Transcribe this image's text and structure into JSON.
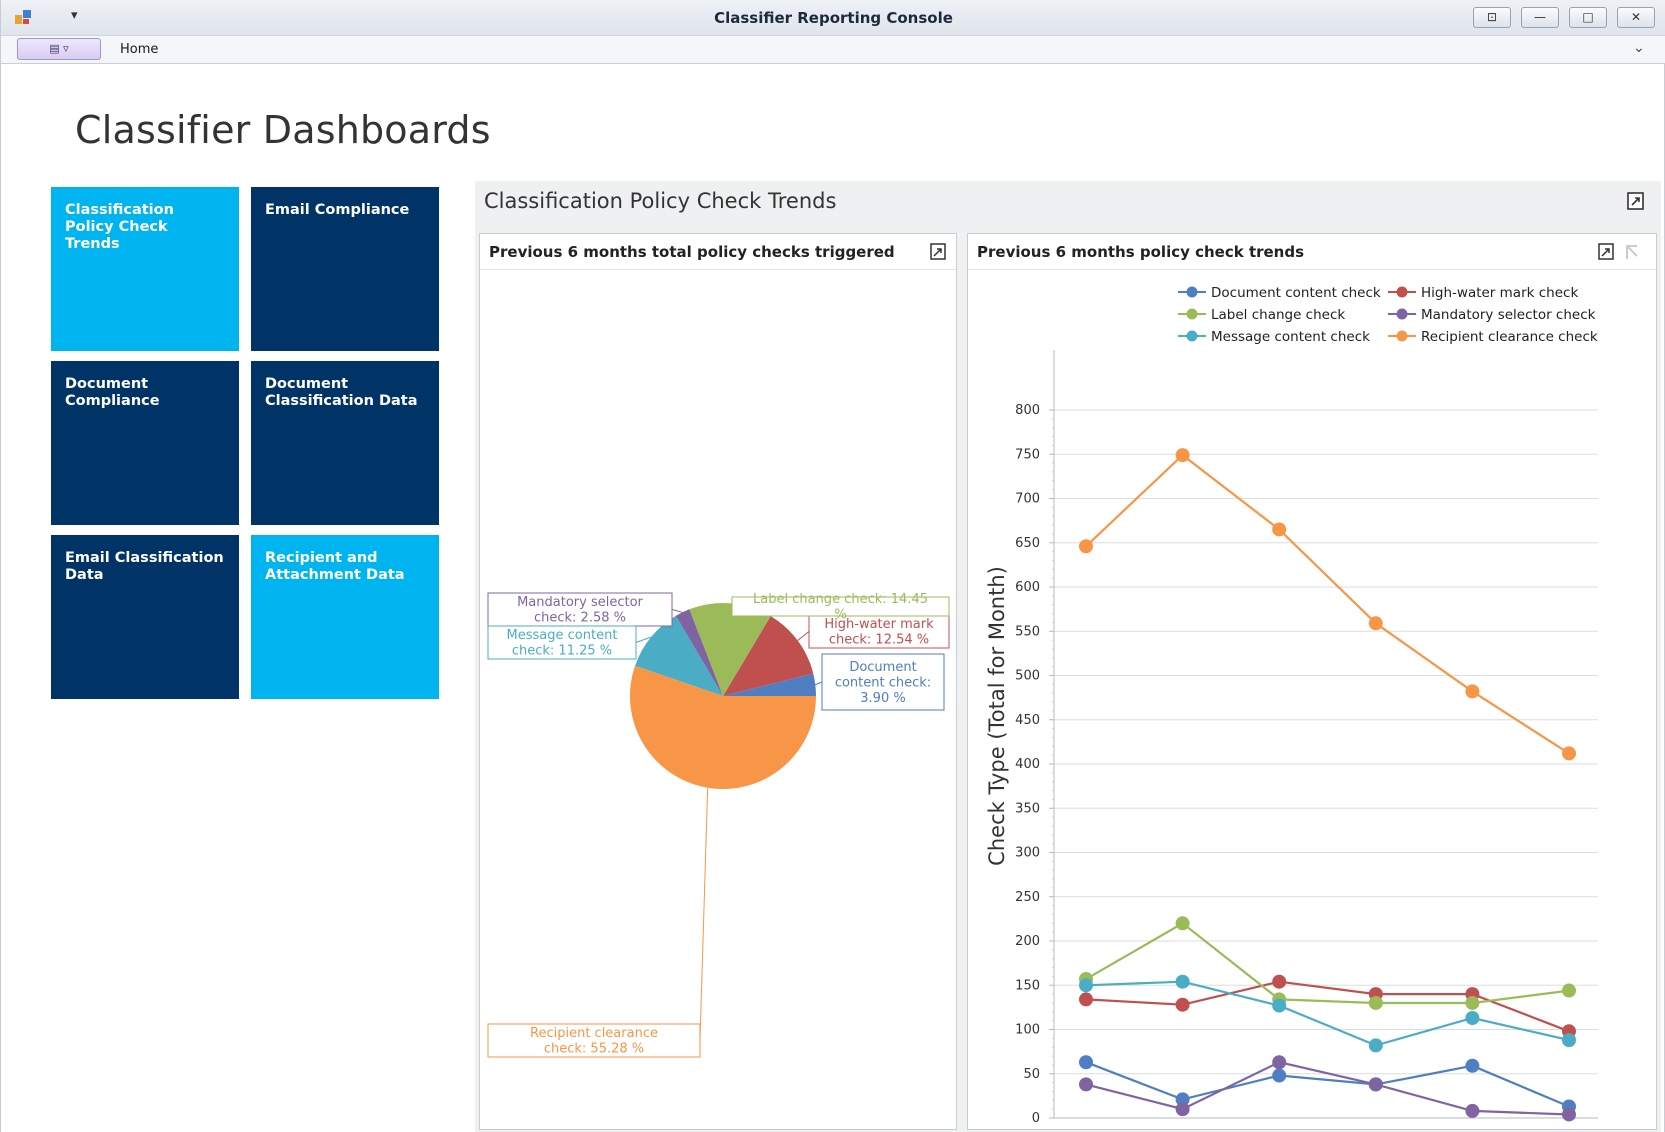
{
  "window": {
    "title": "Classifier Reporting Console"
  },
  "ribbon": {
    "tab_home": "Home"
  },
  "page": {
    "title": "Classifier Dashboards"
  },
  "tiles": [
    {
      "label": "Classification Policy Check Trends",
      "style": "light"
    },
    {
      "label": "Email Compliance",
      "style": "dark"
    },
    {
      "label": "Document Compliance",
      "style": "dark"
    },
    {
      "label": "Document Classification Data",
      "style": "dark"
    },
    {
      "label": "Email Classification Data",
      "style": "dark"
    },
    {
      "label": "Recipient and Attachment Data",
      "style": "light"
    }
  ],
  "dashboard": {
    "title": "Classification Policy Check Trends"
  },
  "colors": {
    "tile_light": "#00b4f0",
    "tile_dark": "#003466",
    "document_content": "#4f7ec3",
    "high_water_mark": "#c0504d",
    "label_change": "#9bbb59",
    "mandatory_selector": "#8064a2",
    "message_content": "#4bacc6",
    "recipient_clearance": "#f79646"
  },
  "chart_data": [
    {
      "type": "pie",
      "title": "Previous 6 months total policy checks triggered",
      "slices": [
        {
          "label": "Document content check: 3.90 %",
          "value": 3.9,
          "color": "#4f7ec3"
        },
        {
          "label": "High-water mark check: 12.54 %",
          "value": 12.54,
          "color": "#c0504d"
        },
        {
          "label": "Label change check: 14.45 %",
          "value": 14.45,
          "color": "#9bbb59"
        },
        {
          "label": "Mandatory selector check: 2.58 %",
          "value": 2.58,
          "color": "#8064a2"
        },
        {
          "label": "Message content check: 11.25 %",
          "value": 11.25,
          "color": "#4bacc6"
        },
        {
          "label": "Recipient clearance check: 55.28 %",
          "value": 55.28,
          "color": "#f79646"
        }
      ]
    },
    {
      "type": "line",
      "title": "Previous 6 months policy check trends",
      "ylabel": "Check Type (Total for Month)",
      "ylim": [
        0,
        800
      ],
      "yticks": [
        0,
        50,
        100,
        150,
        200,
        250,
        300,
        350,
        400,
        450,
        500,
        550,
        600,
        650,
        700,
        750,
        800
      ],
      "grid": true,
      "legend_position": "top-right",
      "x_count": 6,
      "series": [
        {
          "name": "Document content check",
          "color": "#4f7ec3",
          "values": [
            63,
            21,
            48,
            38,
            59,
            13
          ]
        },
        {
          "name": "High-water mark check",
          "color": "#c0504d",
          "values": [
            134,
            128,
            154,
            140,
            140,
            98
          ]
        },
        {
          "name": "Label change check",
          "color": "#9bbb59",
          "values": [
            157,
            220,
            134,
            130,
            130,
            144
          ]
        },
        {
          "name": "Mandatory selector check",
          "color": "#8064a2",
          "values": [
            38,
            10,
            63,
            38,
            8,
            4
          ]
        },
        {
          "name": "Message content check",
          "color": "#4bacc6",
          "values": [
            150,
            154,
            127,
            82,
            113,
            88
          ]
        },
        {
          "name": "Recipient clearance check",
          "color": "#f79646",
          "values": [
            646,
            749,
            665,
            559,
            482,
            412
          ]
        }
      ]
    }
  ]
}
